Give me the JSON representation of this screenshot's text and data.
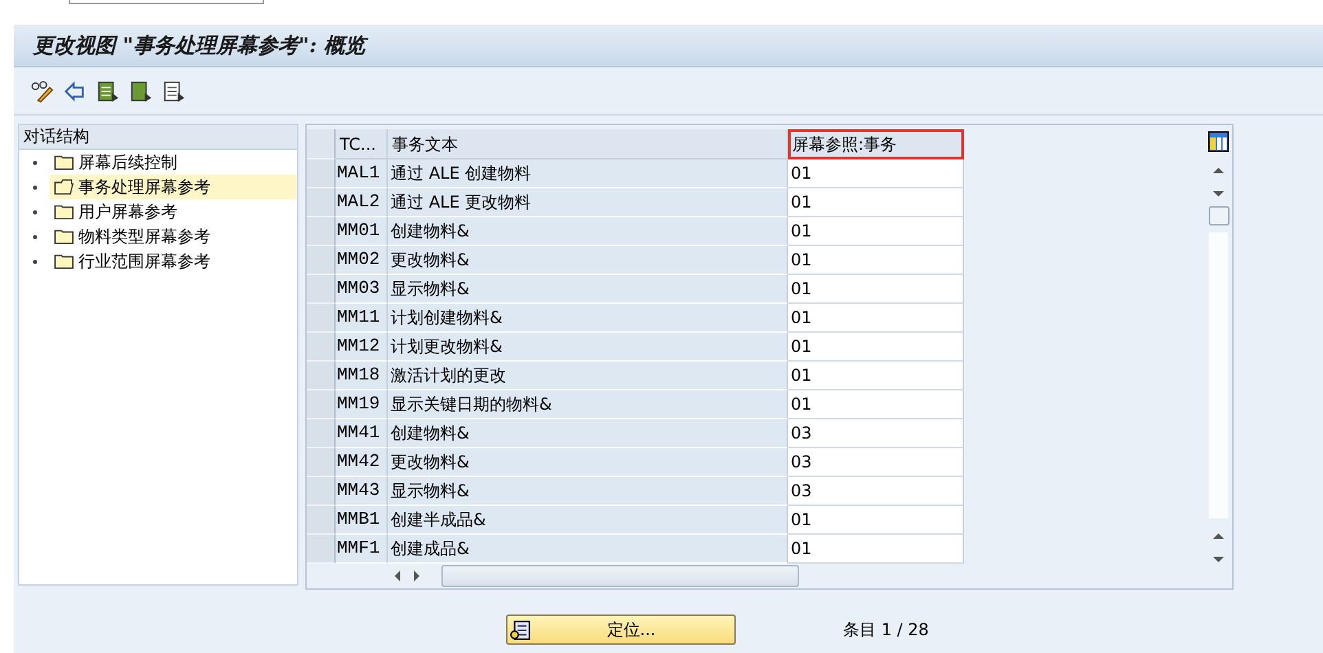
{
  "window": {
    "title": "更改视图 \"事务处理屏幕参考\": 概览"
  },
  "sidebar": {
    "title": "对话结构",
    "items": [
      {
        "label": "屏幕后续控制",
        "selected": false
      },
      {
        "label": "事务处理屏幕参考",
        "selected": true
      },
      {
        "label": "用户屏幕参考",
        "selected": false
      },
      {
        "label": "物料类型屏幕参考",
        "selected": false
      },
      {
        "label": "行业范围屏幕参考",
        "selected": false
      }
    ]
  },
  "table": {
    "columns": [
      {
        "label": "TC...",
        "highlighted": false
      },
      {
        "label": "事务文本",
        "highlighted": false
      },
      {
        "label": "屏幕参照:事务",
        "highlighted": true
      }
    ],
    "rows": [
      [
        "MAL1",
        "通过 ALE 创建物料",
        "01"
      ],
      [
        "MAL2",
        "通过 ALE 更改物料",
        "01"
      ],
      [
        "MM01",
        "创建物料&",
        "01"
      ],
      [
        "MM02",
        "更改物料&",
        "01"
      ],
      [
        "MM03",
        "显示物料&",
        "01"
      ],
      [
        "MM11",
        "计划创建物料&",
        "01"
      ],
      [
        "MM12",
        "计划更改物料&",
        "01"
      ],
      [
        "MM18",
        "激活计划的更改",
        "01"
      ],
      [
        "MM19",
        "显示关键日期的物料&",
        "01"
      ],
      [
        "MM41",
        "创建物料&",
        "03"
      ],
      [
        "MM42",
        "更改物料&",
        "03"
      ],
      [
        "MM43",
        "显示物料&",
        "03"
      ],
      [
        "MMB1",
        "创建半成品&",
        "01"
      ],
      [
        "MMF1",
        "创建成品&",
        "01"
      ]
    ]
  },
  "position_button": {
    "label": "定位..."
  },
  "entry_count": "条目 1 / 28"
}
